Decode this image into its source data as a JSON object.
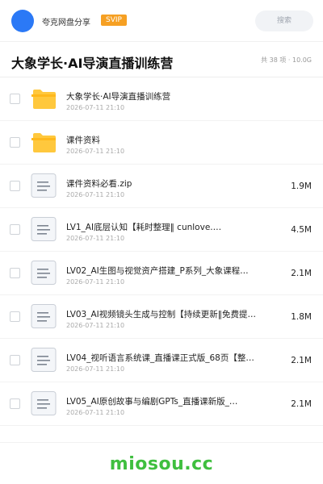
{
  "header": {
    "share_name": "夸克网盘分享",
    "badge": "SVIP",
    "search_placeholder": "搜索",
    "accent_color": "#2b79f6"
  },
  "folder": {
    "title": "大象学长·AI导演直播训练营",
    "meta": "共 38 项 · 10.0G"
  },
  "files": [
    {
      "type": "folder",
      "icon": "folder-icon",
      "name": "大象学长·AI导演直播训练营",
      "date": "2026-07-11 21:10",
      "size": ""
    },
    {
      "type": "folder",
      "icon": "folder-icon",
      "name": "课件资料",
      "date": "2026-07-11 21:10",
      "size": ""
    },
    {
      "type": "file",
      "icon": "document-icon",
      "name": "课件资料必看.zip",
      "date": "2026-07-11 21:10",
      "size": "1.9M"
    },
    {
      "type": "file",
      "icon": "document-icon",
      "name": "LV1_AI底层认知【耗时整理‖ cunlove.…",
      "date": "2026-07-11 21:10",
      "size": "4.5M"
    },
    {
      "type": "file",
      "icon": "document-icon",
      "name": "LV02_AI生图与视觉资产搭建_P系列_大象课程…",
      "date": "2026-07-11 21:10",
      "size": "2.1M"
    },
    {
      "type": "file",
      "icon": "document-icon",
      "name": "LV03_AI视频镜头生成与控制【持续更新‖免费提…",
      "date": "2026-07-11 21:10",
      "size": "1.8M"
    },
    {
      "type": "file",
      "icon": "document-icon",
      "name": "LV04_视听语言系统课_直播课正式版_68页【整…",
      "date": "2026-07-11 21:10",
      "size": "2.1M"
    },
    {
      "type": "file",
      "icon": "document-icon",
      "name": "LV05_AI原创故事与编剧GPTs_直播课新版_…",
      "date": "2026-07-11 21:10",
      "size": "2.1M"
    }
  ],
  "footer": {
    "brand": "miosou.cc",
    "brand_color": "#3fbf3f"
  }
}
